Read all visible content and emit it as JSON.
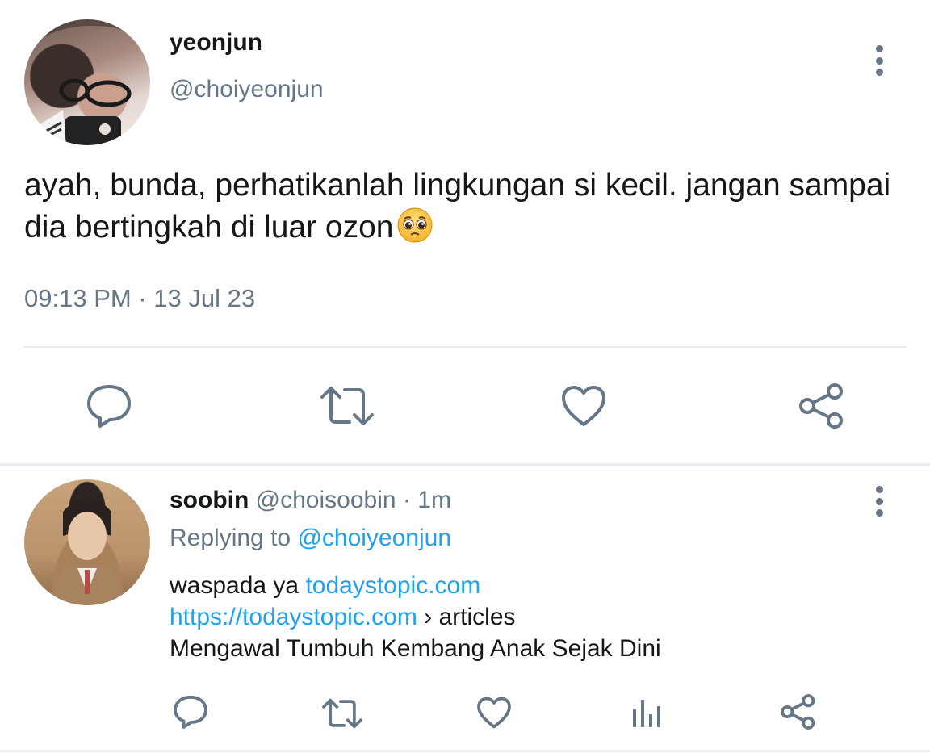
{
  "main_tweet": {
    "display_name": "yeonjun",
    "handle": "@choiyeonjun",
    "text": "ayah, bunda, perhatikanlah lingkungan si kecil. jangan sampai dia bertingkah di luar ozon",
    "emoji": "pleading-face",
    "timestamp": "09:13 PM · 13 Jul 23",
    "actions": [
      "reply-icon",
      "retweet-icon",
      "like-icon",
      "share-icon"
    ]
  },
  "reply_tweet": {
    "display_name": "soobin",
    "handle": "@choisoobin",
    "separator": "·",
    "time_ago": "1m",
    "replying_label": "Replying to",
    "replying_handle": "@choiyeonjun",
    "body_line1_text": "waspada ya",
    "body_line1_link": "todaystopic.com",
    "body_line2_link": "https://todaystopic.com",
    "body_line2_text": "› articles",
    "body_line3_text": "Mengawal Tumbuh Kembang Anak Sejak Dini",
    "actions": [
      "reply-icon",
      "retweet-icon",
      "like-icon",
      "analytics-icon",
      "share-icon"
    ]
  },
  "colors": {
    "text_primary": "#14171a",
    "text_secondary": "#657786",
    "link": "#1da1f2",
    "divider": "#e6ecf0"
  }
}
